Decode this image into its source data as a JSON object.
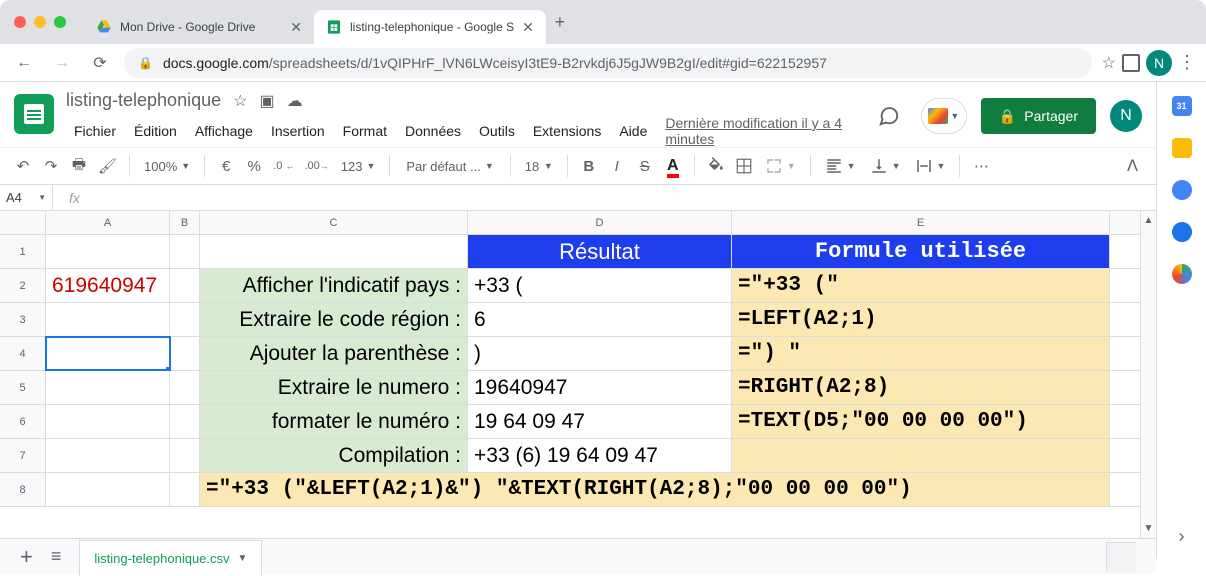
{
  "browser": {
    "tab1_title": "Mon Drive - Google Drive",
    "tab2_title": "listing-telephonique - Google S",
    "url_host": "docs.google.com",
    "url_path": "/spreadsheets/d/1vQIPHrF_lVN6LWceisyI3tE9-B2rvkdj6J5gJW9B2gI/edit#gid=622152957",
    "avatar_letter": "N"
  },
  "sheets": {
    "doc_title": "listing-telephonique",
    "last_edit": "Dernière modification il y a 4 minutes",
    "share_label": "Partager",
    "menus": [
      "Fichier",
      "Édition",
      "Affichage",
      "Insertion",
      "Format",
      "Données",
      "Outils",
      "Extensions",
      "Aide"
    ]
  },
  "toolbar": {
    "zoom": "100%",
    "currency": "€",
    "percent": "%",
    "dec_less": ".0",
    "dec_more": ".00",
    "num_format": "123",
    "font_name": "Par défaut ...",
    "font_size": "18"
  },
  "name_box": "A4",
  "cols": {
    "A": "A",
    "B": "B",
    "C": "C",
    "D": "D",
    "E": "E"
  },
  "rows": {
    "r1": {
      "num": "1",
      "D": "Résultat",
      "E": "Formule utilisée"
    },
    "r2": {
      "num": "2",
      "A": "619640947",
      "C": "Afficher l'indicatif pays :",
      "D": "+33 (",
      "E": "=\"+33 (\""
    },
    "r3": {
      "num": "3",
      "C": "Extraire le code région :",
      "D": "6",
      "E": "=LEFT(A2;1)"
    },
    "r4": {
      "num": "4",
      "C": "Ajouter la parenthèse  :",
      "D": ")",
      "E": "=\") \""
    },
    "r5": {
      "num": "5",
      "C": "Extraire le numero :",
      "D": "19640947",
      "E": "=RIGHT(A2;8)"
    },
    "r6": {
      "num": "6",
      "C": "formater le numéro :",
      "D": "19 64 09 47",
      "E": "=TEXT(D5;\"00 00 00 00\")"
    },
    "r7": {
      "num": "7",
      "C": "Compilation :",
      "D": "+33 (6) 19 64 09 47",
      "E": ""
    },
    "r8": {
      "num": "8",
      "formula": "=\"+33 (\"&LEFT(A2;1)&\") \"&TEXT(RIGHT(A2;8);\"00 00 00 00\")"
    }
  },
  "sheet_tab": "listing-telephonique.csv"
}
